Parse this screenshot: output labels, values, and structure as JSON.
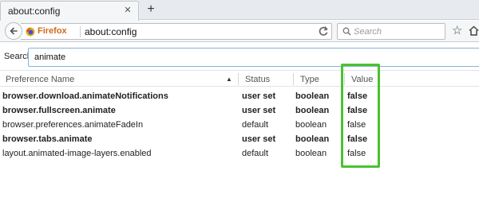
{
  "tabs": [
    {
      "title": "about:config"
    }
  ],
  "new_tab_label": "+",
  "close_tab_label": "✕",
  "urlbar": {
    "identity_label": "Firefox",
    "url": "about:config"
  },
  "searchbar": {
    "placeholder": "Search"
  },
  "config_search": {
    "label": "Search:",
    "value": "animate"
  },
  "columns": {
    "name": "Preference Name",
    "status": "Status",
    "type": "Type",
    "value": "Value"
  },
  "rows": [
    {
      "name": "browser.download.animateNotifications",
      "status": "user set",
      "type": "boolean",
      "value": "false",
      "modified": true
    },
    {
      "name": "browser.fullscreen.animate",
      "status": "user set",
      "type": "boolean",
      "value": "false",
      "modified": true
    },
    {
      "name": "browser.preferences.animateFadeIn",
      "status": "default",
      "type": "boolean",
      "value": "false",
      "modified": false
    },
    {
      "name": "browser.tabs.animate",
      "status": "user set",
      "type": "boolean",
      "value": "false",
      "modified": true
    },
    {
      "name": "layout.animated-image-layers.enabled",
      "status": "default",
      "type": "boolean",
      "value": "false",
      "modified": false
    }
  ],
  "colors": {
    "highlight": "#4ac22f",
    "firefox_brand": "#d06a18",
    "search_focus_border": "#86b3d8"
  },
  "icons": {
    "back": "back-arrow-icon",
    "firefox": "firefox-logo-icon",
    "reload": "reload-icon",
    "search": "search-icon",
    "bookmark": "star-icon",
    "home": "home-icon",
    "sort": "sort-ascending-icon"
  }
}
